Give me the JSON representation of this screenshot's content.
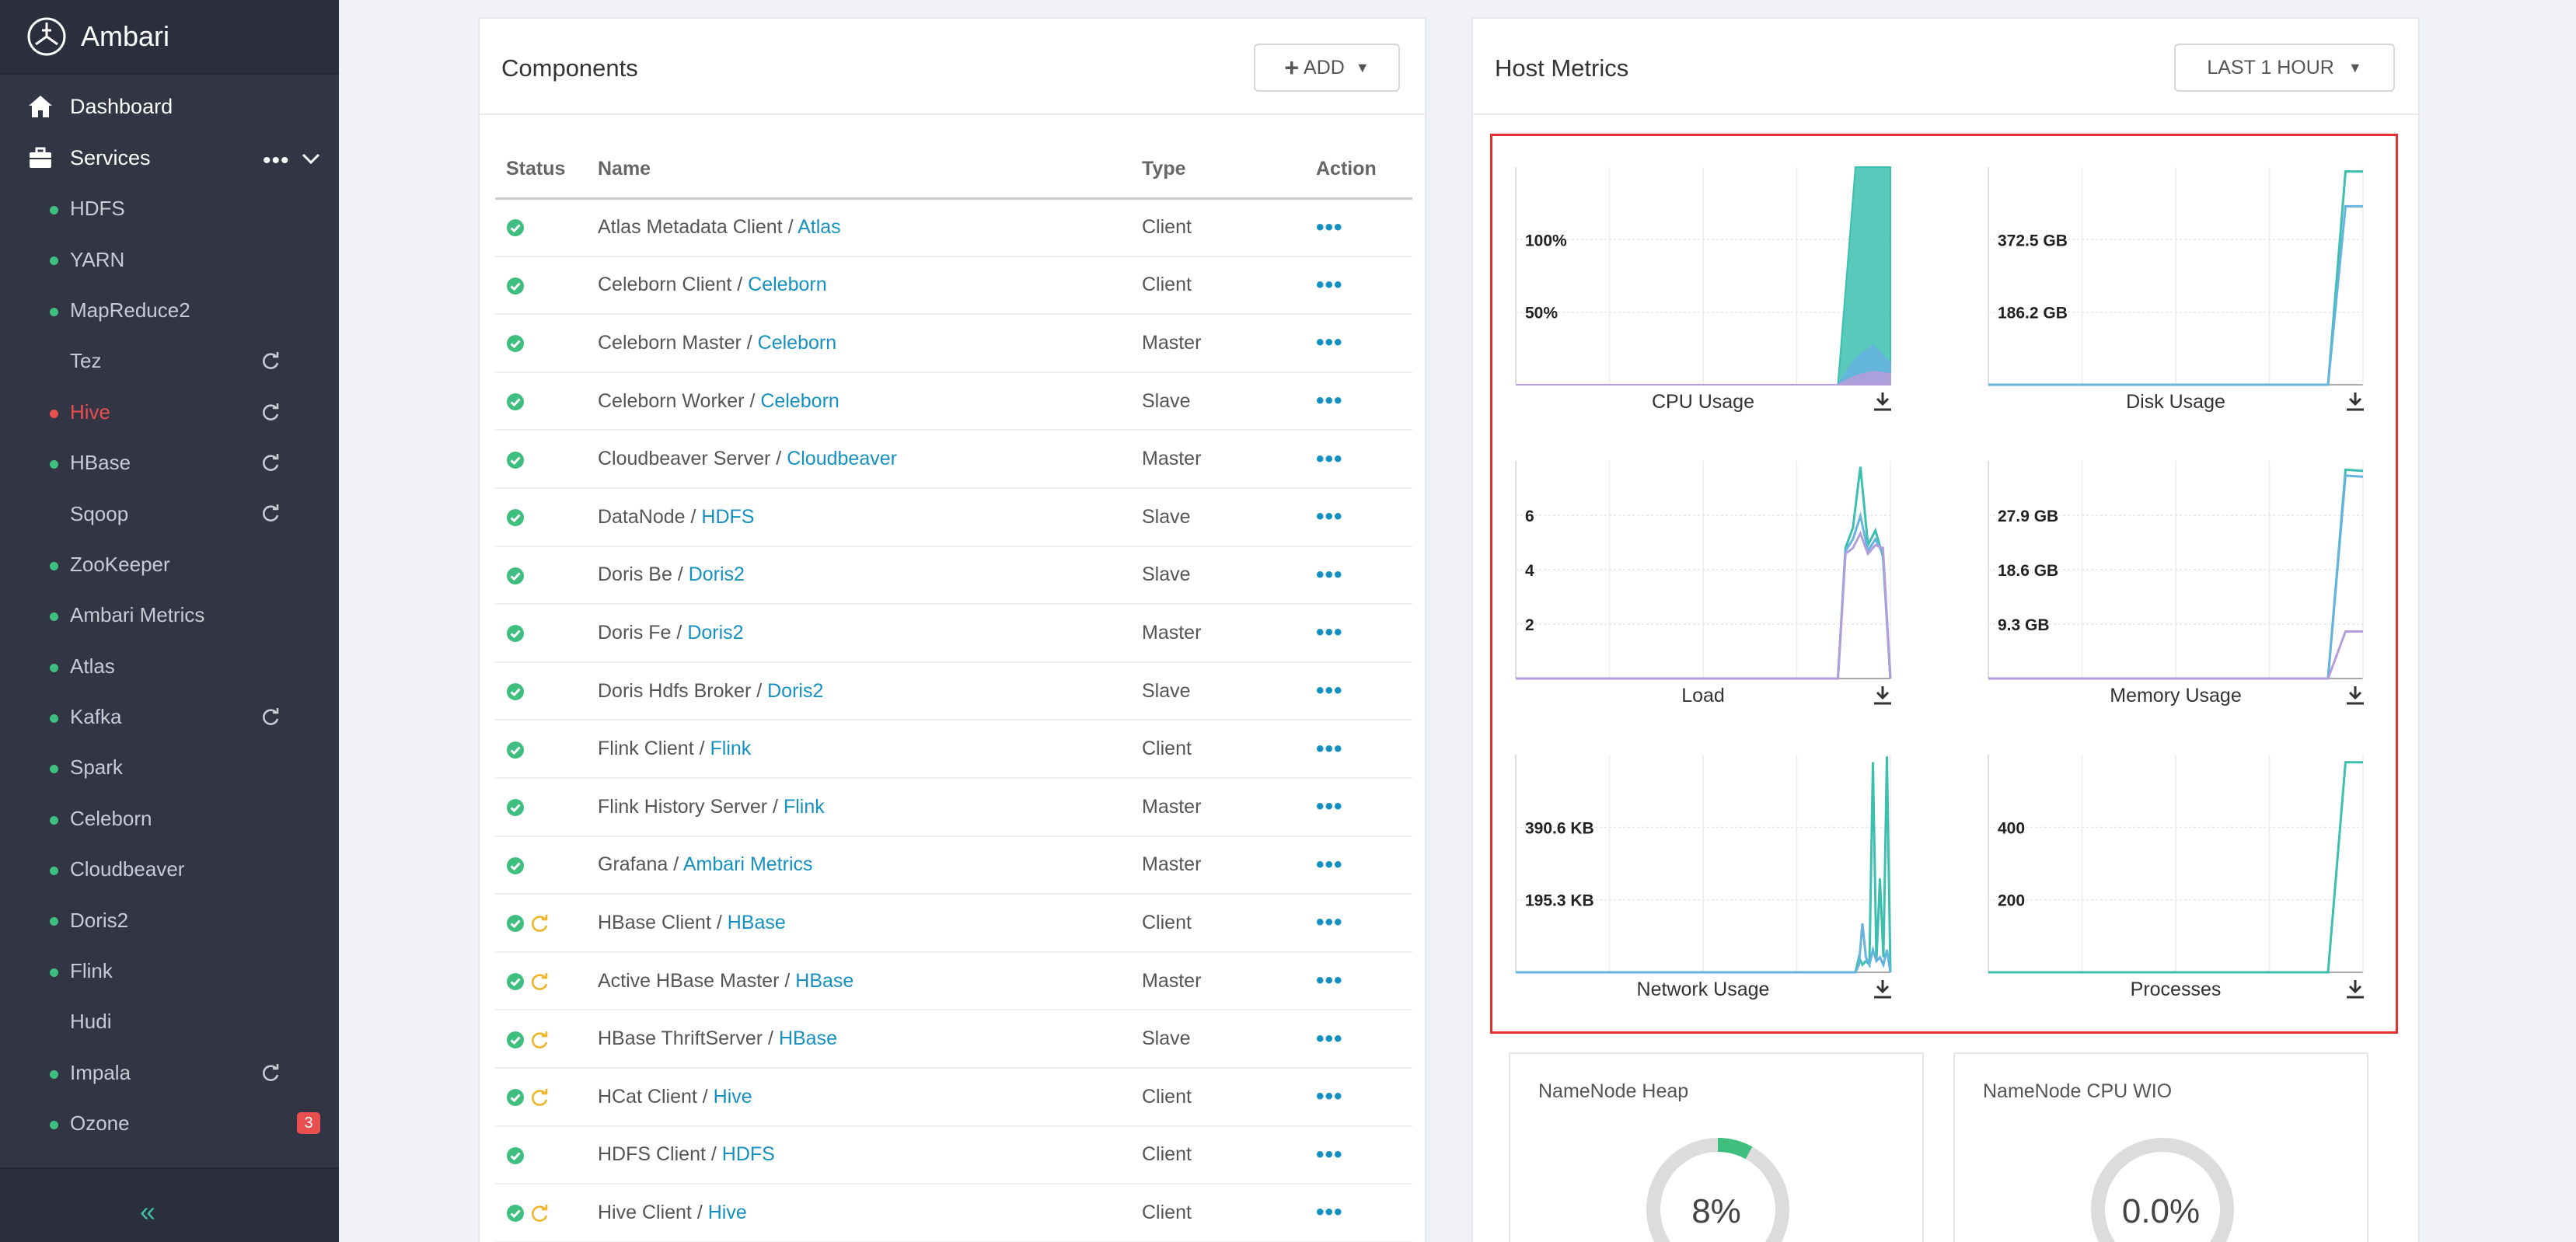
{
  "app": {
    "title": "Ambari"
  },
  "nav": {
    "dashboard": "Dashboard",
    "services": "Services",
    "services_more": "•••",
    "items": [
      {
        "name": "HDFS",
        "status": "ok",
        "refresh": false
      },
      {
        "name": "YARN",
        "status": "ok",
        "refresh": false
      },
      {
        "name": "MapReduce2",
        "status": "ok",
        "refresh": false
      },
      {
        "name": "Tez",
        "status": "none",
        "refresh": true
      },
      {
        "name": "Hive",
        "status": "critical",
        "refresh": true
      },
      {
        "name": "HBase",
        "status": "ok",
        "refresh": true
      },
      {
        "name": "Sqoop",
        "status": "none",
        "refresh": true
      },
      {
        "name": "ZooKeeper",
        "status": "ok",
        "refresh": false
      },
      {
        "name": "Ambari Metrics",
        "status": "ok",
        "refresh": false
      },
      {
        "name": "Atlas",
        "status": "ok",
        "refresh": false
      },
      {
        "name": "Kafka",
        "status": "ok",
        "refresh": true
      },
      {
        "name": "Spark",
        "status": "ok",
        "refresh": false
      },
      {
        "name": "Celeborn",
        "status": "ok",
        "refresh": false
      },
      {
        "name": "Cloudbeaver",
        "status": "ok",
        "refresh": false
      },
      {
        "name": "Doris2",
        "status": "ok",
        "refresh": false
      },
      {
        "name": "Flink",
        "status": "ok",
        "refresh": false
      },
      {
        "name": "Hudi",
        "status": "none",
        "refresh": false
      },
      {
        "name": "Impala",
        "status": "ok",
        "refresh": true
      },
      {
        "name": "Ozone",
        "status": "ok",
        "refresh": false,
        "alerts": "3"
      }
    ]
  },
  "components": {
    "title": "Components",
    "add_label": "ADD",
    "columns": {
      "status": "Status",
      "name": "Name",
      "type": "Type",
      "action": "Action"
    },
    "rows": [
      {
        "component": "Atlas Metadata Client",
        "service": "Atlas",
        "type": "Client",
        "restart": false
      },
      {
        "component": "Celeborn Client",
        "service": "Celeborn",
        "type": "Client",
        "restart": false
      },
      {
        "component": "Celeborn Master",
        "service": "Celeborn",
        "type": "Master",
        "restart": false
      },
      {
        "component": "Celeborn Worker",
        "service": "Celeborn",
        "type": "Slave",
        "restart": false
      },
      {
        "component": "Cloudbeaver Server",
        "service": "Cloudbeaver",
        "type": "Master",
        "restart": false
      },
      {
        "component": "DataNode",
        "service": "HDFS",
        "type": "Slave",
        "restart": false
      },
      {
        "component": "Doris Be",
        "service": "Doris2",
        "type": "Slave",
        "restart": false
      },
      {
        "component": "Doris Fe",
        "service": "Doris2",
        "type": "Master",
        "restart": false
      },
      {
        "component": "Doris Hdfs Broker",
        "service": "Doris2",
        "type": "Slave",
        "restart": false
      },
      {
        "component": "Flink Client",
        "service": "Flink",
        "type": "Client",
        "restart": false
      },
      {
        "component": "Flink History Server",
        "service": "Flink",
        "type": "Master",
        "restart": false
      },
      {
        "component": "Grafana",
        "service": "Ambari Metrics",
        "type": "Master",
        "restart": false
      },
      {
        "component": "HBase Client",
        "service": "HBase",
        "type": "Client",
        "restart": true
      },
      {
        "component": "Active HBase Master",
        "service": "HBase",
        "type": "Master",
        "restart": true
      },
      {
        "component": "HBase ThriftServer",
        "service": "HBase",
        "type": "Slave",
        "restart": true
      },
      {
        "component": "HCat Client",
        "service": "Hive",
        "type": "Client",
        "restart": true
      },
      {
        "component": "HDFS Client",
        "service": "HDFS",
        "type": "Client",
        "restart": false
      },
      {
        "component": "Hive Client",
        "service": "Hive",
        "type": "Client",
        "restart": true
      }
    ]
  },
  "host_metrics": {
    "title": "Host Metrics",
    "range_label": "LAST 1 HOUR"
  },
  "chart_data": [
    {
      "type": "area",
      "title": "CPU Usage",
      "y_ticks": [
        "100%",
        "50%"
      ],
      "ylim": [
        0,
        100
      ],
      "x": [
        0,
        1,
        2,
        3,
        4,
        5,
        6,
        7,
        8,
        9,
        10
      ],
      "series": [
        {
          "values": [
            0,
            0,
            0,
            0,
            0,
            0,
            0,
            0,
            100,
            100,
            100
          ]
        },
        {
          "values": [
            0,
            0,
            0,
            0,
            0,
            0,
            0,
            0,
            12,
            18,
            10
          ]
        },
        {
          "values": [
            0,
            0,
            0,
            0,
            0,
            0,
            0,
            0,
            4,
            6,
            5
          ]
        }
      ]
    },
    {
      "type": "line",
      "title": "Disk Usage",
      "y_ticks": [
        "372.5 GB",
        "186.2 GB"
      ],
      "ylim": [
        0,
        500
      ],
      "x": [
        0,
        1,
        2,
        3,
        4,
        5,
        6,
        7,
        8,
        9,
        10
      ],
      "series": [
        {
          "values": [
            0,
            0,
            0,
            0,
            0,
            0,
            0,
            0,
            0,
            490,
            490
          ]
        },
        {
          "values": [
            0,
            0,
            0,
            0,
            0,
            0,
            0,
            0,
            0,
            410,
            410
          ]
        }
      ]
    },
    {
      "type": "line",
      "title": "Load",
      "y_ticks": [
        "6",
        "4",
        "2"
      ],
      "ylim": [
        0,
        7.5
      ],
      "x": [
        0,
        1,
        2,
        3,
        4,
        5,
        6,
        7,
        8,
        9,
        10,
        11,
        12,
        13,
        14
      ],
      "series": [
        {
          "values": [
            0,
            0,
            0,
            0,
            0,
            0,
            0,
            0,
            4.5,
            5.2,
            7.3,
            4.6,
            5.1,
            4.2,
            0
          ]
        },
        {
          "values": [
            0,
            0,
            0,
            0,
            0,
            0,
            0,
            0,
            4.4,
            4.8,
            5.6,
            4.4,
            4.8,
            4.3,
            0
          ]
        },
        {
          "values": [
            0,
            0,
            0,
            0,
            0,
            0,
            0,
            0,
            4.3,
            4.5,
            5,
            4.3,
            4.6,
            4.5,
            0
          ]
        }
      ]
    },
    {
      "type": "line",
      "title": "Memory Usage",
      "y_ticks": [
        "27.9 GB",
        "18.6 GB",
        "9.3 GB"
      ],
      "ylim": [
        0,
        37
      ],
      "x": [
        0,
        1,
        2,
        3,
        4,
        5,
        6,
        7,
        8,
        9,
        10
      ],
      "series": [
        {
          "values": [
            0,
            0,
            0,
            0,
            0,
            0,
            0,
            0,
            0,
            35.5,
            35.3
          ]
        },
        {
          "values": [
            0,
            0,
            0,
            0,
            0,
            0,
            0,
            0,
            0,
            34.5,
            34.3
          ]
        },
        {
          "values": [
            0,
            0,
            0,
            0,
            0,
            0,
            0,
            0,
            0,
            8,
            8
          ]
        }
      ]
    },
    {
      "type": "line",
      "title": "Network Usage",
      "y_ticks": [
        "390.6 KB",
        "195.3 KB"
      ],
      "ylim": [
        0,
        580
      ],
      "x": [
        0,
        1,
        2,
        3,
        4,
        5,
        6,
        7,
        8,
        9,
        10,
        11,
        12,
        13,
        14,
        15,
        16,
        17,
        18,
        19,
        20,
        21,
        22
      ],
      "series": [
        {
          "values": [
            0,
            0,
            0,
            0,
            0,
            0,
            0,
            0,
            0,
            0,
            0,
            0,
            0,
            40,
            20,
            30,
            20,
            560,
            30,
            250,
            40,
            575,
            0
          ]
        },
        {
          "values": [
            0,
            0,
            0,
            0,
            0,
            0,
            0,
            0,
            0,
            0,
            0,
            0,
            0,
            20,
            130,
            40,
            20,
            60,
            30,
            40,
            20,
            60,
            0
          ]
        }
      ]
    },
    {
      "type": "line",
      "title": "Processes",
      "y_ticks": [
        "400",
        "200"
      ],
      "ylim": [
        0,
        430
      ],
      "x": [
        0,
        1,
        2,
        3,
        4,
        5,
        6,
        7,
        8,
        9,
        10
      ],
      "series": [
        {
          "values": [
            0,
            0,
            0,
            0,
            0,
            0,
            0,
            0,
            0,
            415,
            415
          ]
        }
      ]
    }
  ],
  "widgets": [
    {
      "title": "NameNode Heap",
      "value": "8%",
      "fill": 0.08
    },
    {
      "title": "NameNode CPU WIO",
      "value": "0.0%",
      "fill": 0
    }
  ],
  "colors": {
    "sidebar": "#323544",
    "ok": "#3fbf7f",
    "critical": "#e94f4f",
    "link": "#1491c1",
    "warning": "#f0b429",
    "chart_teal": "#3bbfae",
    "chart_blue": "#66b3de",
    "chart_purple": "#b39ddb"
  }
}
